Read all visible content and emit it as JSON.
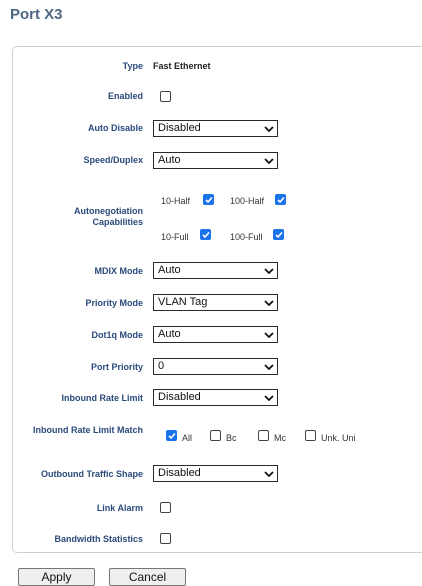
{
  "page": {
    "title": "Port X3"
  },
  "fields": {
    "type": {
      "label": "Type",
      "value": "Fast Ethernet"
    },
    "enabled": {
      "label": "Enabled",
      "checked": false
    },
    "auto_disable": {
      "label": "Auto Disable",
      "value": "Disabled"
    },
    "speed_duplex": {
      "label": "Speed/Duplex",
      "value": "Auto"
    },
    "autoneg": {
      "label": "Autonegotiation Capabilities",
      "options": [
        {
          "label": "10-Half",
          "checked": true
        },
        {
          "label": "100-Half",
          "checked": true
        },
        {
          "label": "10-Full",
          "checked": true
        },
        {
          "label": "100-Full",
          "checked": true
        }
      ]
    },
    "mdix_mode": {
      "label": "MDIX Mode",
      "value": "Auto"
    },
    "priority_mode": {
      "label": "Priority Mode",
      "value": "VLAN Tag"
    },
    "dot1q_mode": {
      "label": "Dot1q Mode",
      "value": "Auto"
    },
    "port_priority": {
      "label": "Port Priority",
      "value": "0"
    },
    "inbound_rate_limit": {
      "label": "Inbound Rate Limit",
      "value": "Disabled"
    },
    "inbound_rate_limit_match": {
      "label": "Inbound Rate Limit Match",
      "options": [
        {
          "label": "All",
          "checked": true
        },
        {
          "label": "Bc",
          "checked": false
        },
        {
          "label": "Mc",
          "checked": false
        },
        {
          "label": "Unk. Uni",
          "checked": false
        }
      ]
    },
    "outbound_traffic_shape": {
      "label": "Outbound Traffic Shape",
      "value": "Disabled"
    },
    "link_alarm": {
      "label": "Link Alarm",
      "checked": false
    },
    "bandwidth_statistics": {
      "label": "Bandwidth Statistics",
      "checked": false
    }
  },
  "buttons": {
    "apply": "Apply",
    "cancel": "Cancel"
  },
  "colors": {
    "title": "#4e6781",
    "label": "#2a4a7b",
    "checkbox_checked": "#1a73e8"
  }
}
